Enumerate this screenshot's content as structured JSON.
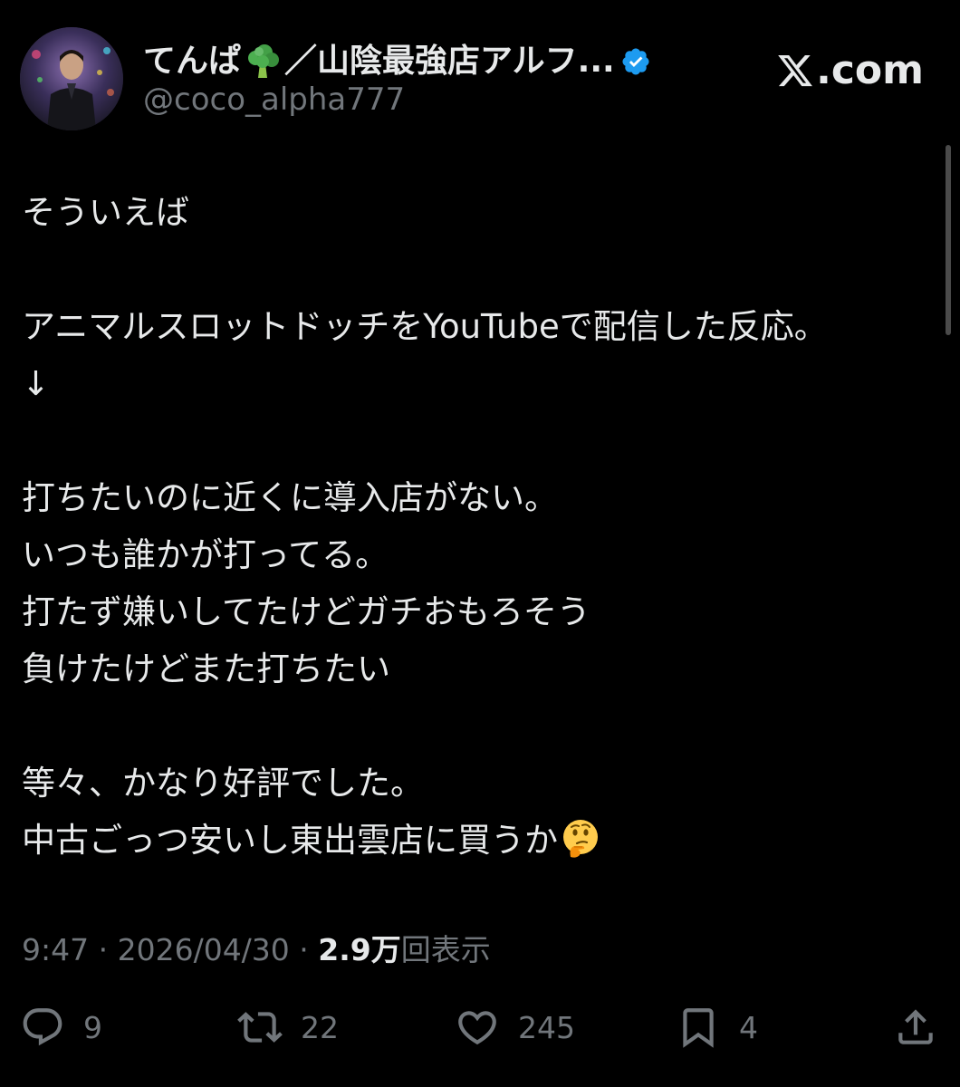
{
  "author": {
    "name_part1": "てんぱ",
    "name_part2": "／山陰最強店アルフ...",
    "emoji_icon": "broccoli-icon",
    "verified_color": "#1d9bf0",
    "handle": "@coco_alpha777"
  },
  "brand": {
    "text": ".com",
    "icon": "x-logo-icon"
  },
  "tweet": {
    "lines": [
      "そういえば",
      "",
      "アニマルスロットドッチをYouTubeで配信した反応。",
      "↓",
      "",
      "打ちたいのに近くに導入店がない。",
      "いつも誰かが打ってる。",
      "打たず嫌いしてたけどガチおもろそう",
      "負けたけどまた打ちたい",
      "",
      "等々、かなり好評でした。",
      "中古ごっつ安いし東出雲店に買うか"
    ],
    "trailing_emoji": "thinking-face-icon"
  },
  "meta": {
    "time": "9:47",
    "separator1": " · ",
    "date": "2026/04/30",
    "separator2": " · ",
    "views_count": "2.9万",
    "views_label": "回表示"
  },
  "actions": {
    "reply_count": "9",
    "retweet_count": "22",
    "like_count": "245",
    "bookmark_count": "4"
  },
  "colors": {
    "background": "#000000",
    "text": "#e7e9ea",
    "secondary": "#71767b",
    "accent": "#1d9bf0"
  }
}
